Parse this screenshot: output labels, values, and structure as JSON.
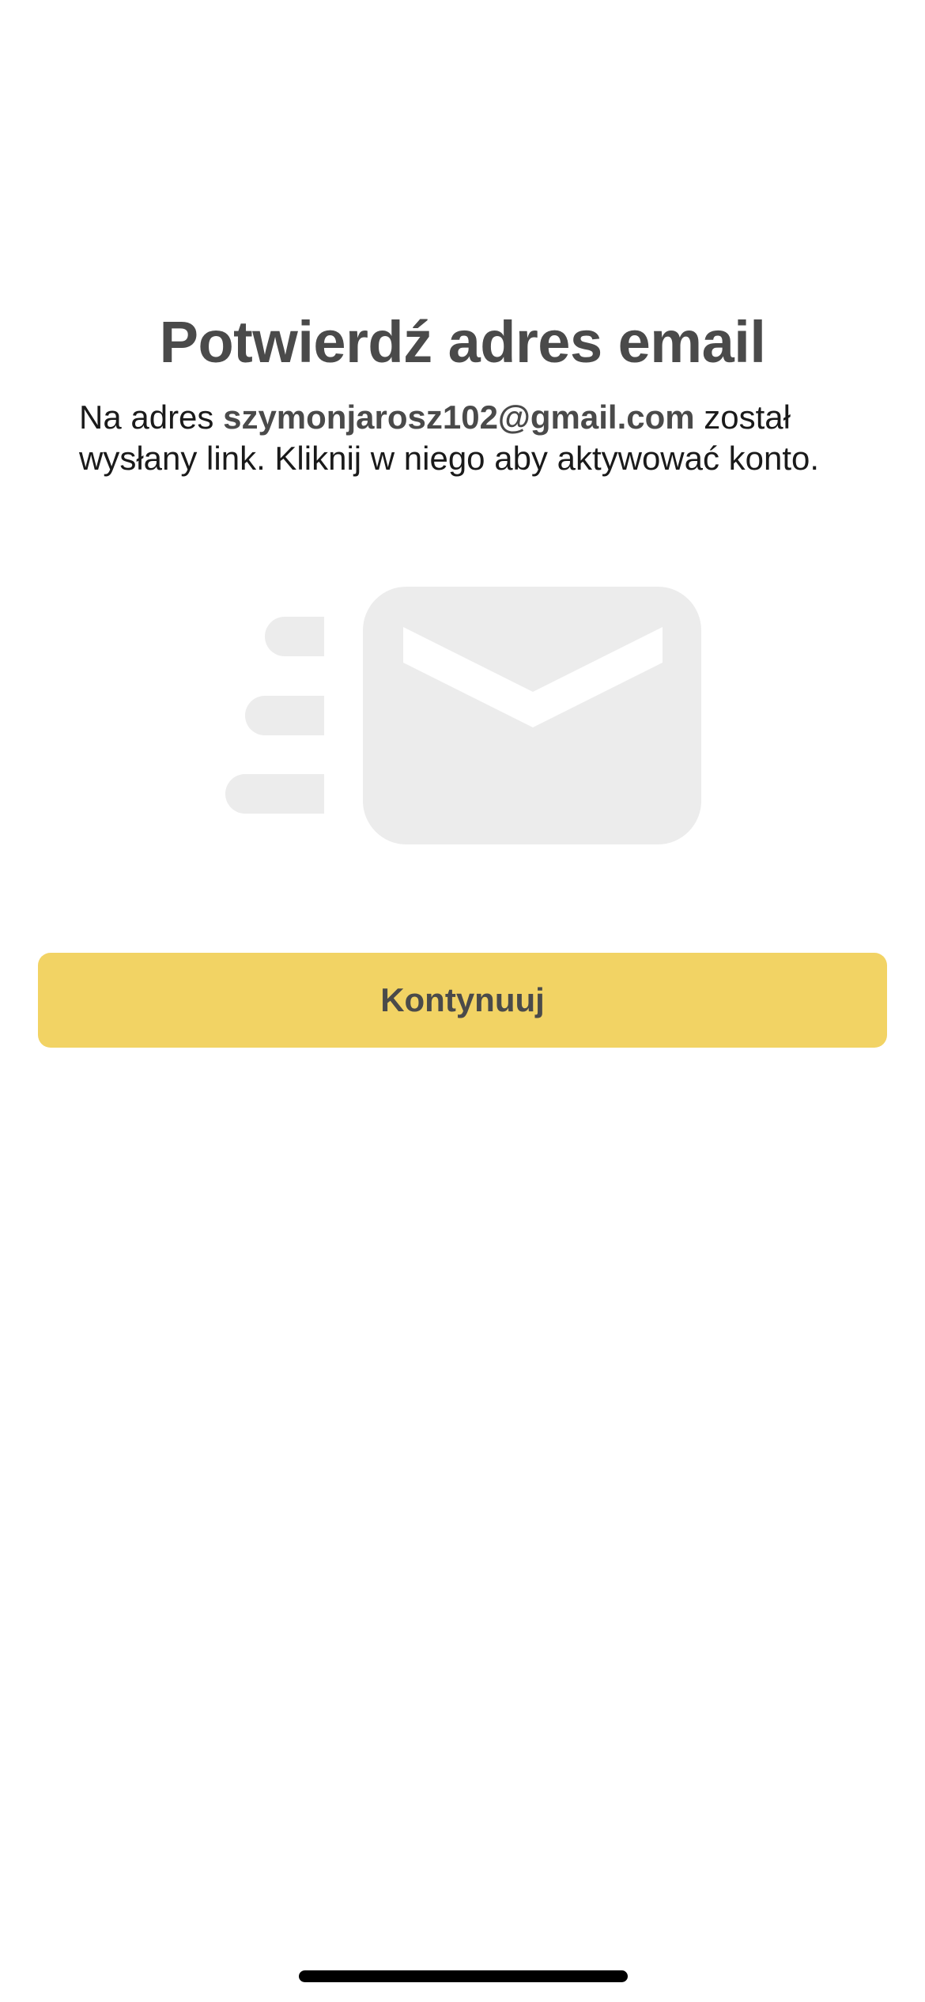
{
  "screen": {
    "title": "Potwierdź adres email",
    "message_prefix": "Na adres ",
    "email": "szymonjarosz102@gmail.com",
    "message_suffix": " został wysłany link. Kliknij w niego aby aktywować konto."
  },
  "illustration": {
    "icon": "mail-sending-icon",
    "color": "#ececec"
  },
  "actions": {
    "continue_label": "Kontynuuj",
    "continue_color": "#f2d364"
  },
  "system": {
    "home_indicator": "home-indicator"
  }
}
